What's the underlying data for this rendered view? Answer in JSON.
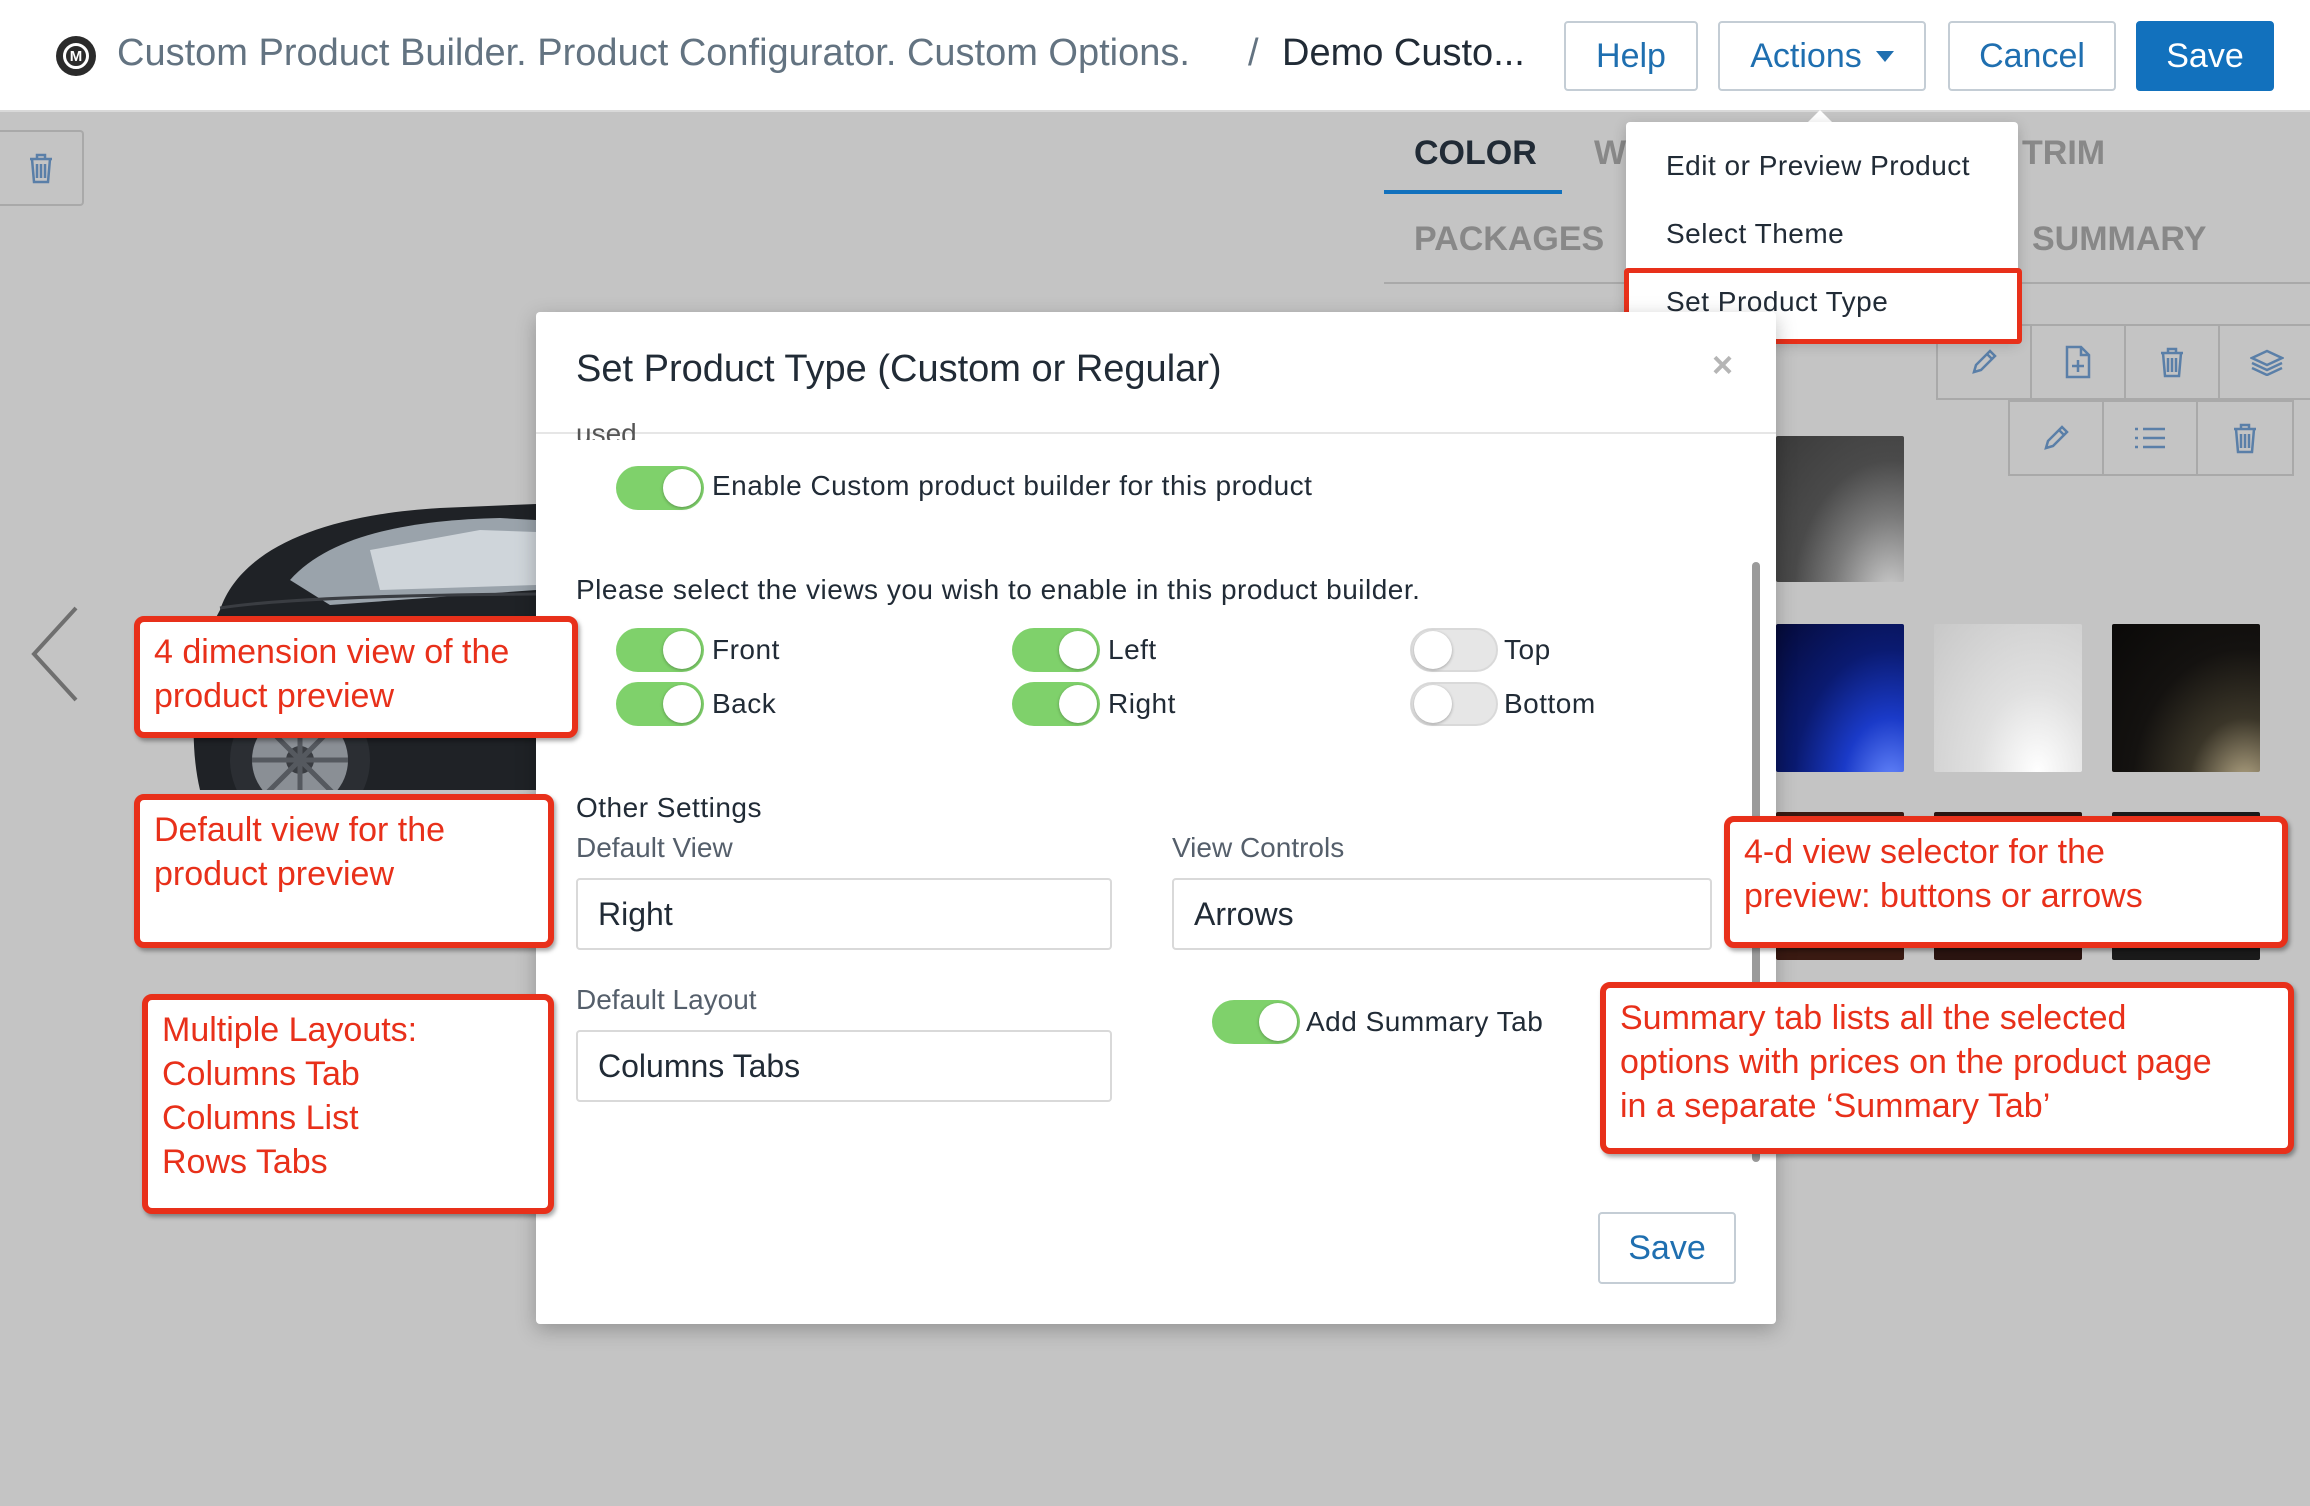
{
  "header": {
    "app_title": "Custom Product Builder. Product Configurator. Custom Options.",
    "separator": "/",
    "current_page": "Demo Custo...",
    "help_label": "Help",
    "actions_label": "Actions",
    "cancel_label": "Cancel",
    "save_label": "Save"
  },
  "actions_menu": {
    "items": [
      "Edit or Preview Product",
      "Select Theme",
      "Set Product Type"
    ],
    "highlighted": "Set Product Type"
  },
  "background_tabs": {
    "row1": [
      "COLOR",
      "W",
      "TRIM"
    ],
    "row2": [
      "PACKAGES",
      "SUMMARY"
    ],
    "active": "COLOR"
  },
  "modal": {
    "title": "Set Product Type (Custom or Regular)",
    "close_glyph": "×",
    "clipped_text": "used.",
    "enable_label": "Enable Custom product builder for this product",
    "enable_on": true,
    "views_prompt": "Please select the views you wish to enable in this product builder.",
    "views": [
      {
        "label": "Front",
        "on": true
      },
      {
        "label": "Back",
        "on": true
      },
      {
        "label": "Left",
        "on": true
      },
      {
        "label": "Right",
        "on": true
      },
      {
        "label": "Top",
        "on": false
      },
      {
        "label": "Bottom",
        "on": false
      }
    ],
    "other_settings_heading": "Other Settings",
    "default_view_label": "Default View",
    "default_view_value": "Right",
    "view_controls_label": "View Controls",
    "view_controls_value": "Arrows",
    "default_layout_label": "Default Layout",
    "default_layout_value": "Columns Tabs",
    "summary_tab_label": "Add Summary Tab",
    "summary_tab_on": true,
    "save_label": "Save"
  },
  "annotations": {
    "views": [
      "4 dimension view of the",
      "product preview"
    ],
    "default_view": [
      "Default view for the",
      "product preview"
    ],
    "layouts": [
      "Multiple Layouts:",
      "Columns Tab",
      "Columns List",
      "Rows Tabs"
    ],
    "selector": [
      "4-d view selector for the",
      "preview: buttons or arrows"
    ],
    "summary": [
      "Summary tab lists all the selected",
      "options with prices on the product page",
      "in a separate ‘Summary Tab’"
    ]
  },
  "colors": {
    "primary": "#1271bd",
    "toggle_on": "#7fd16b",
    "annotation": "#e8301a",
    "backdrop": "#c4c4c4"
  }
}
